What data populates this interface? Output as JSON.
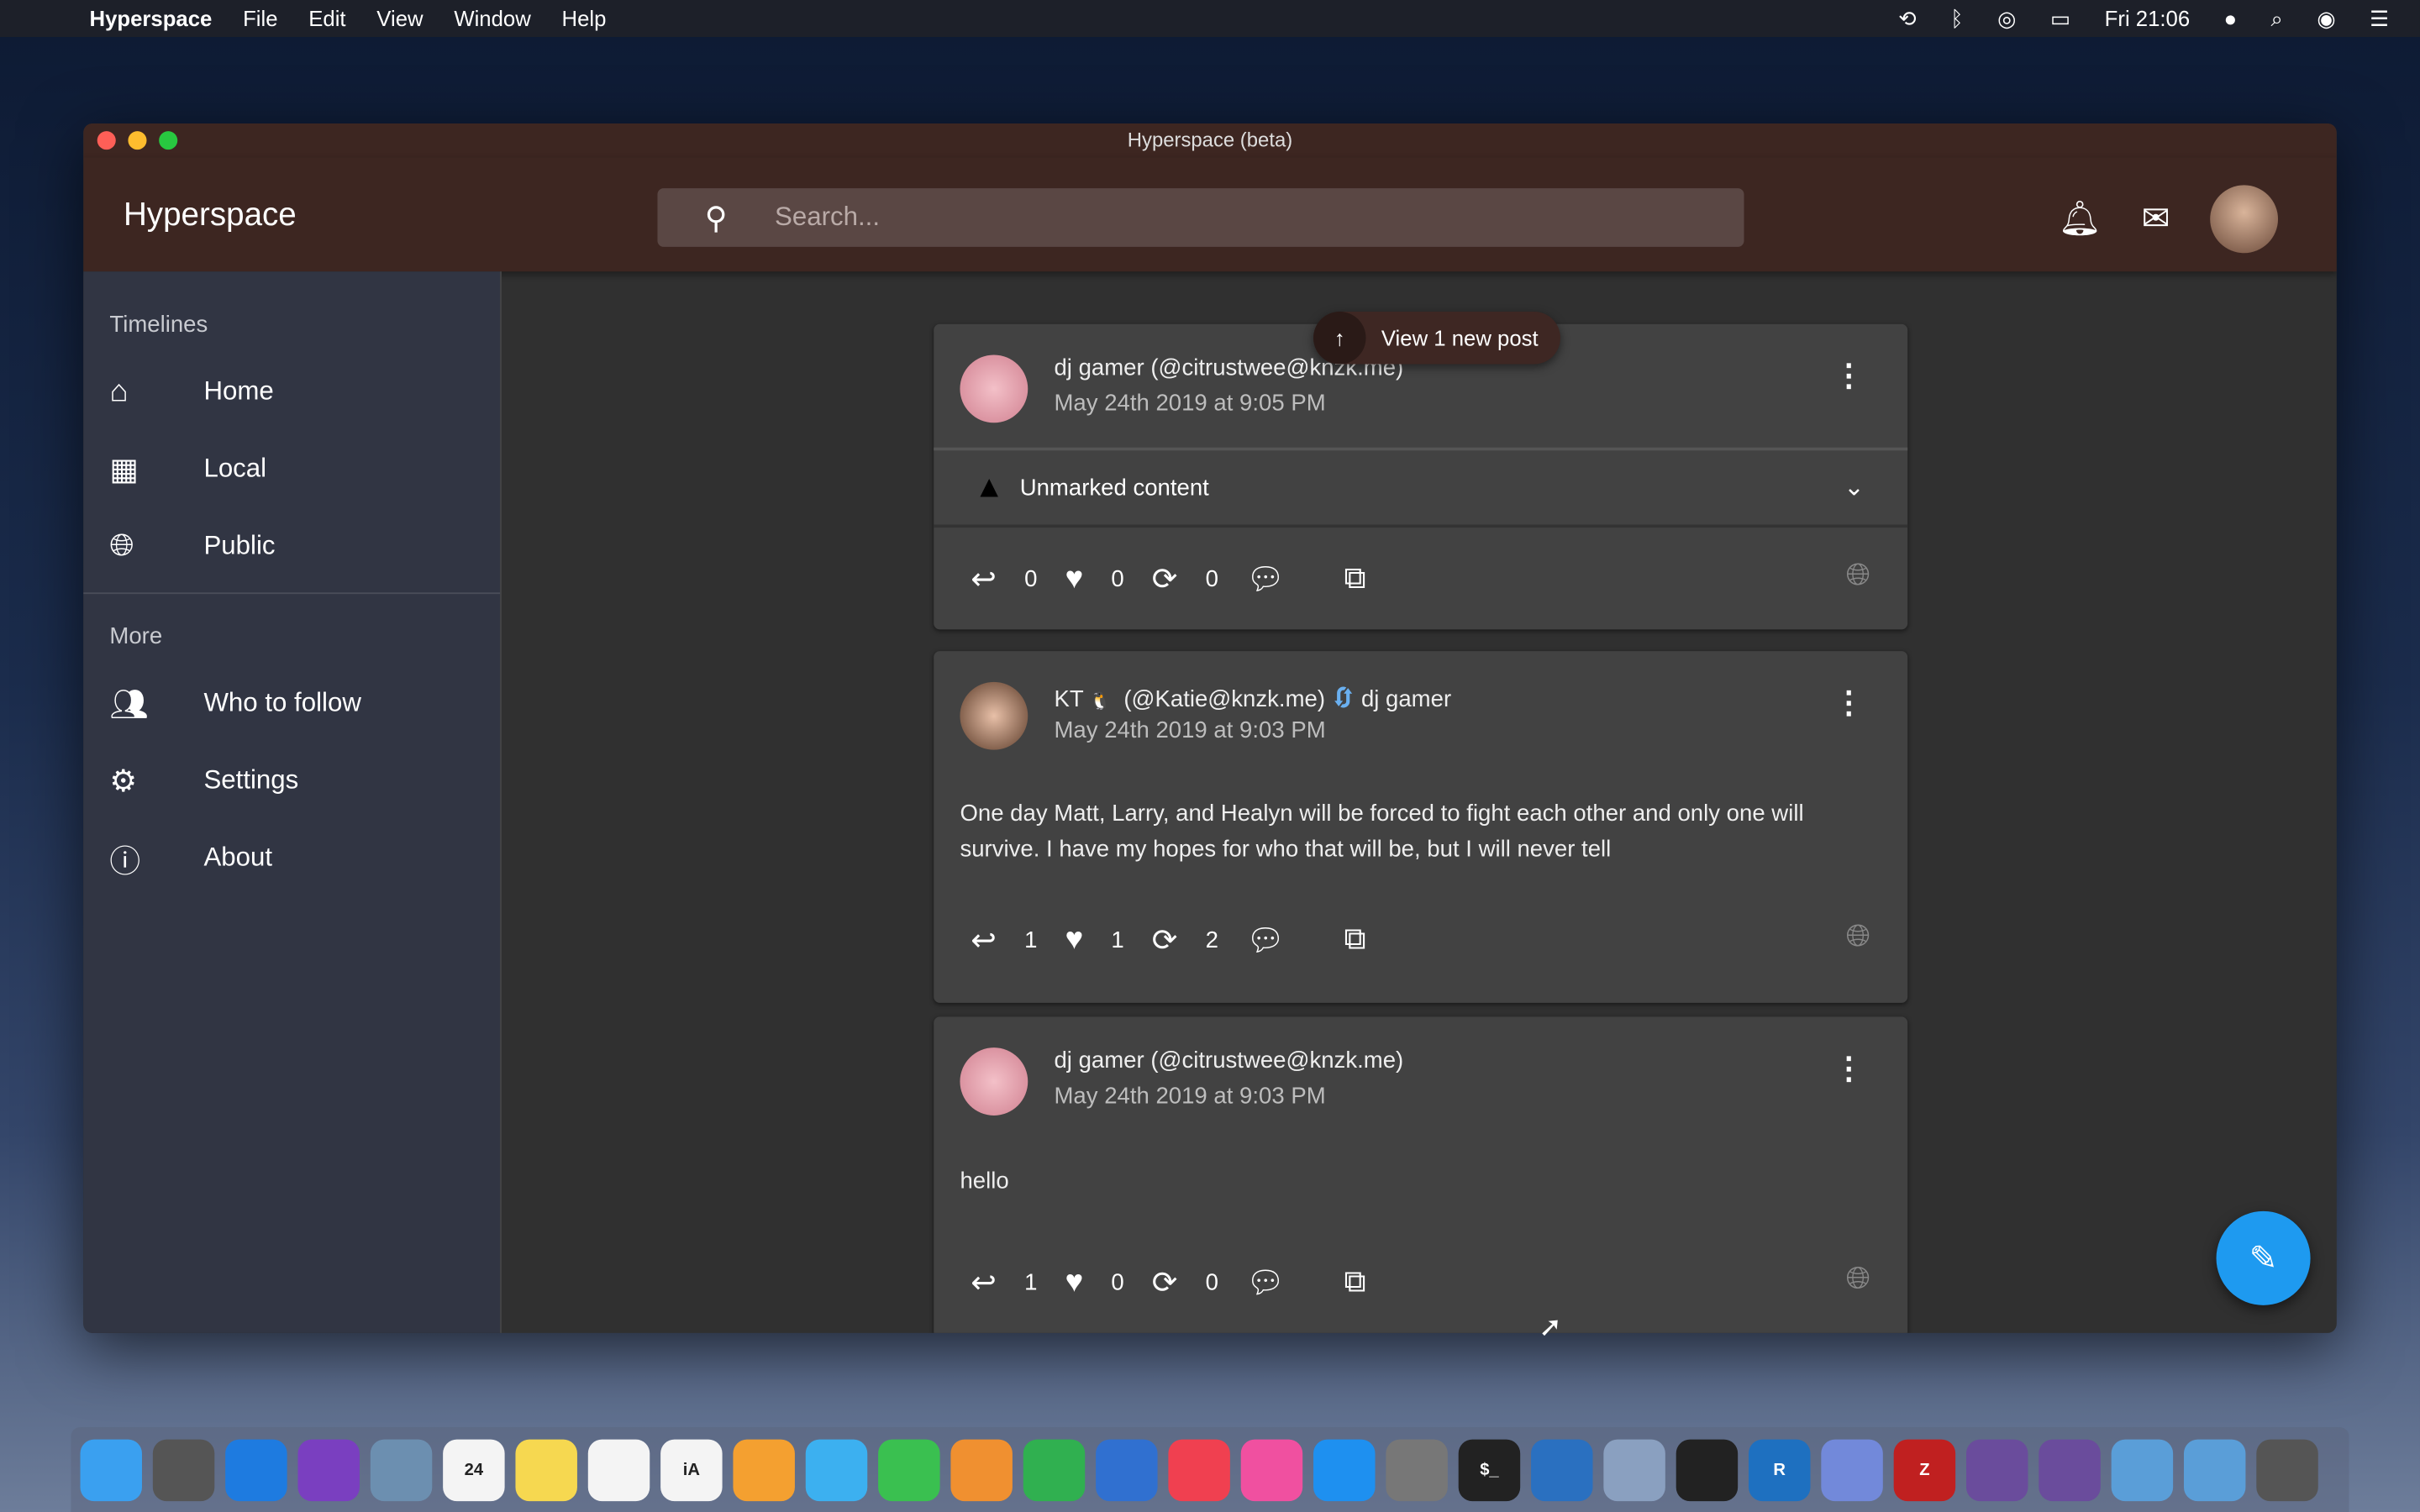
{
  "menubar": {
    "app": "Hyperspace",
    "menus": [
      "File",
      "Edit",
      "View",
      "Window",
      "Help"
    ],
    "clock": "Fri 21:06",
    "status_icons": [
      "time-machine-icon",
      "bluetooth-icon",
      "wifi-icon",
      "battery-icon",
      "dot-icon",
      "spotlight-icon",
      "siri-icon",
      "notification-center-icon"
    ]
  },
  "window": {
    "title": "Hyperspace (beta)"
  },
  "header": {
    "brand": "Hyperspace",
    "search_placeholder": "Search...",
    "search_value": ""
  },
  "sidebar": {
    "timelines_label": "Timelines",
    "timelines": [
      {
        "label": "Home",
        "icon": "home-icon"
      },
      {
        "label": "Local",
        "icon": "building-icon"
      },
      {
        "label": "Public",
        "icon": "globe-icon"
      }
    ],
    "more_label": "More",
    "more": [
      {
        "label": "Who to follow",
        "icon": "people-icon"
      },
      {
        "label": "Settings",
        "icon": "gear-icon"
      },
      {
        "label": "About",
        "icon": "info-icon"
      }
    ]
  },
  "new_post_banner": "View 1 new post",
  "posts": [
    {
      "name": "dj gamer (@citrustwee@knzk.me)",
      "date": "May 24th 2019 at 9:05 PM",
      "content_warning": "Unmarked content",
      "replies": "0",
      "favorites": "0",
      "boosts": "0"
    },
    {
      "name": "KT",
      "emoji": "🐧",
      "handle": "(@Katie@knzk.me)",
      "boosted_by": "dj gamer",
      "date": "May 24th 2019 at 9:03 PM",
      "text": "One day Matt, Larry, and Healyn will be forced to fight each other and only one will survive. I have my hopes for who that will be, but I will never tell",
      "replies": "1",
      "favorites": "1",
      "boosts": "2"
    },
    {
      "name": "dj gamer (@citrustwee@knzk.me)",
      "date": "May 24th 2019 at 9:03 PM",
      "text": "hello",
      "replies": "1",
      "favorites": "0",
      "boosts": "0"
    }
  ],
  "dock": [
    {
      "name": "Finder",
      "color": "#3aa0f0"
    },
    {
      "name": "Launchpad",
      "color": "#555"
    },
    {
      "name": "Safari",
      "color": "#1e7be0"
    },
    {
      "name": "Safari TP",
      "color": "#7a3fc0"
    },
    {
      "name": "Mail",
      "color": "#6c8fb0"
    },
    {
      "name": "Calendar",
      "color": "#f4f4f4",
      "label": "24"
    },
    {
      "name": "Notes",
      "color": "#f6d850"
    },
    {
      "name": "Reminders",
      "color": "#f4f4f4"
    },
    {
      "name": "iA Writer",
      "color": "#f4f4f4",
      "label": "iA"
    },
    {
      "name": "Photos",
      "color": "#f4a030"
    },
    {
      "name": "Messages",
      "color": "#3cb0f0"
    },
    {
      "name": "FaceTime",
      "color": "#3ac050"
    },
    {
      "name": "Pages",
      "color": "#f09030"
    },
    {
      "name": "Numbers",
      "color": "#30b050"
    },
    {
      "name": "Keynote",
      "color": "#3070d0"
    },
    {
      "name": "News",
      "color": "#f04050"
    },
    {
      "name": "Music",
      "color": "#f050a0"
    },
    {
      "name": "App Store",
      "color": "#1e90f0"
    },
    {
      "name": "System Preferences",
      "color": "#777"
    },
    {
      "name": "Terminal",
      "color": "#222",
      "label": "$_"
    },
    {
      "name": "Xcode",
      "color": "#2a70c0"
    },
    {
      "name": "Preview",
      "color": "#8aa0c0"
    },
    {
      "name": "QuickTime",
      "color": "#222"
    },
    {
      "name": "Rider",
      "color": "#1e70c0",
      "label": "R"
    },
    {
      "name": "Discord",
      "color": "#7289da"
    },
    {
      "name": "Zotero",
      "color": "#c02020",
      "label": "Z"
    },
    {
      "name": "Hyperspace",
      "color": "#6a4c9c"
    },
    {
      "name": "Hyperspace",
      "color": "#6a4c9c"
    },
    {
      "name": "Downloads",
      "color": "#5a9ed8"
    },
    {
      "name": "Folder",
      "color": "#5a9ed8"
    },
    {
      "name": "Trash",
      "color": "#555"
    }
  ],
  "colors": {
    "header": "#3d2621",
    "sidebar": "#313543",
    "card": "#424242",
    "fab": "#1e9af0"
  }
}
